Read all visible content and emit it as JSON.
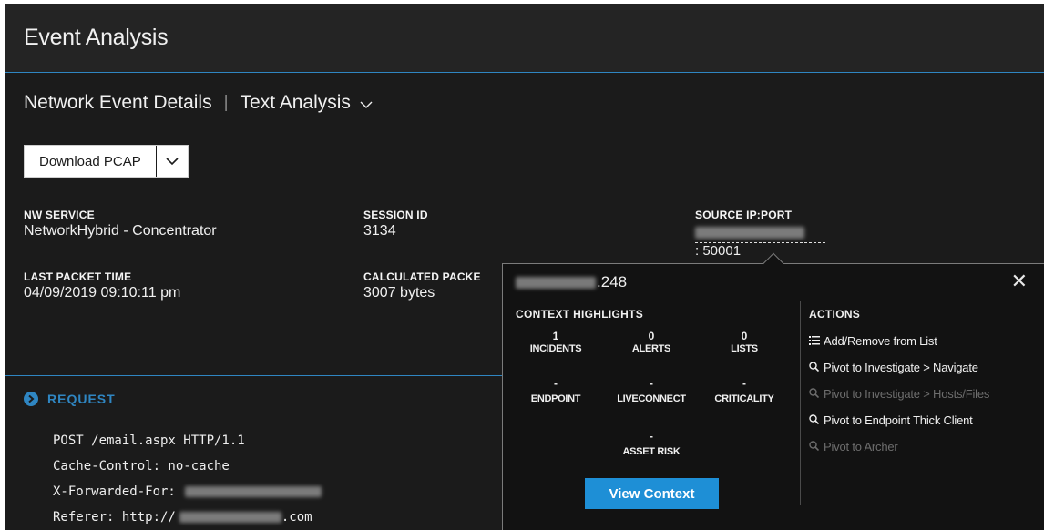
{
  "header": {
    "title": "Event Analysis"
  },
  "subnav": {
    "details_tab": "Network Event Details",
    "separator": "|",
    "analysis_tab": "Text Analysis",
    "download_label": "Download PCAP"
  },
  "meta": {
    "nw_service_label": "NW SERVICE",
    "nw_service_value": "NetworkHybrid - Concentrator",
    "session_id_label": "SESSION ID",
    "session_id_value": "3134",
    "source_label": "SOURCE IP:PORT",
    "source_port": ": 50001",
    "last_packet_label": "LAST PACKET TIME",
    "last_packet_value": "04/09/2019 09:10:11 pm",
    "calc_packet_label": "CALCULATED PACKE",
    "calc_packet_value": "3007 bytes"
  },
  "request": {
    "title": "REQUEST",
    "lines": {
      "l1": "POST /email.aspx HTTP/1.1",
      "l2": "Cache-Control: no-cache",
      "l3": "X-Forwarded-For:",
      "l4_prefix": "Referer: http://",
      "l4_suffix": ".com"
    }
  },
  "popup": {
    "ip_suffix": ".248",
    "close": "✕",
    "highlights_title": "CONTEXT HIGHLIGHTS",
    "incidents": {
      "value": "1",
      "label": "INCIDENTS"
    },
    "alerts": {
      "value": "0",
      "label": "ALERTS"
    },
    "lists": {
      "value": "0",
      "label": "LISTS"
    },
    "endpoint": {
      "value": "-",
      "label": "ENDPOINT"
    },
    "liveconnect": {
      "value": "-",
      "label": "LIVECONNECT"
    },
    "criticality": {
      "value": "-",
      "label": "CRITICALITY"
    },
    "asset_risk": {
      "value": "-",
      "label": "ASSET RISK"
    },
    "view_context": "View Context",
    "actions_title": "ACTIONS",
    "actions": {
      "a1": "Add/Remove from List",
      "a2": "Pivot to Investigate > Navigate",
      "a3": "Pivot to Investigate > Hosts/Files",
      "a4": "Pivot to Endpoint Thick Client",
      "a5": "Pivot to Archer"
    }
  },
  "colors": {
    "accent": "#2f86c2",
    "button": "#1e8fd6",
    "background": "#1b1b1b"
  }
}
